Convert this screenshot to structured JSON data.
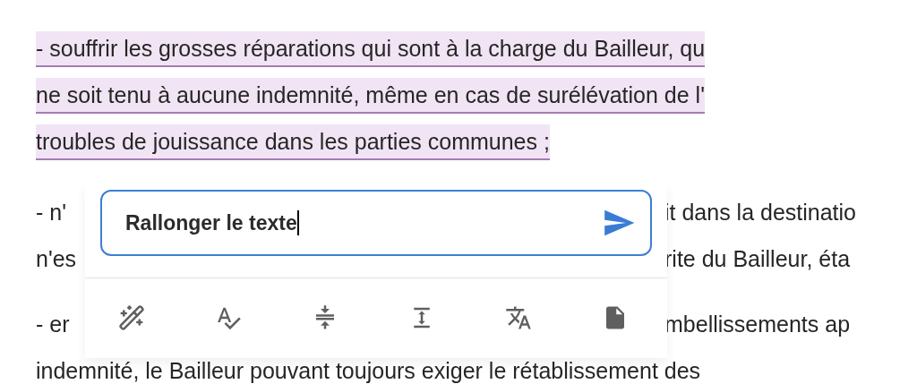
{
  "document": {
    "paragraphs": [
      {
        "highlighted": true,
        "lines": [
          {
            "text": "- souffrir les grosses réparations qui sont à la charge du Bailleur, qu"
          },
          {
            "text": "ne soit tenu à aucune indemnité, même en cas de surélévation de l'"
          },
          {
            "text": "troubles de jouissance dans les parties communes ;"
          }
        ]
      },
      {
        "highlighted": false,
        "lines": [
          {
            "left": "- n'",
            "right": "it dans la destinatio"
          },
          {
            "left": "n'es",
            "right": "rite du Bailleur, éta"
          }
        ]
      },
      {
        "highlighted": false,
        "lines": [
          {
            "left": "- er",
            "right": "mbellissements ap"
          },
          {
            "text": "indemnité, le Bailleur pouvant toujours exiger le rétablissement des"
          }
        ]
      }
    ]
  },
  "ai_popup": {
    "prompt_value": "Rallonger le texte",
    "tools": [
      {
        "kind": "magic"
      },
      {
        "kind": "spellcheck"
      },
      {
        "kind": "shorten"
      },
      {
        "kind": "lengthen"
      },
      {
        "kind": "translate"
      },
      {
        "kind": "document"
      }
    ]
  }
}
